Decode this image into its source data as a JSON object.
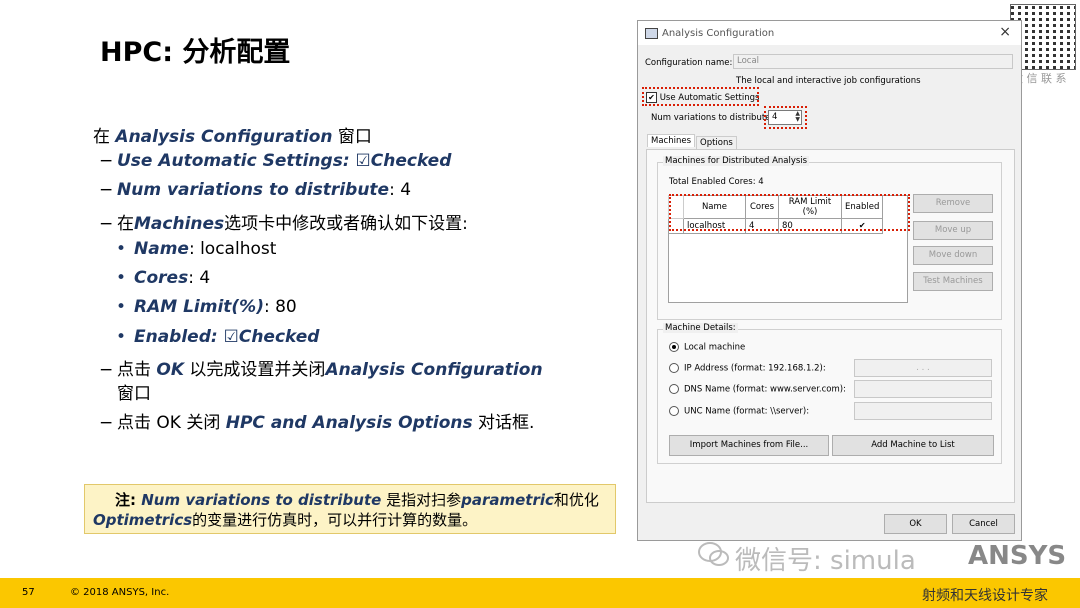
{
  "slide": {
    "title": "HPC: 分析配置",
    "b0_pre": "在 ",
    "b0_kw": "Analysis Configuration",
    "b0_post": " 窗口",
    "b1_dash": "−",
    "b1_kw": "Use Automatic Settings",
    "b1_post": ": ☑Checked",
    "b2_kw": "Num variations to distribute",
    "b2_post": ": 4",
    "b3_pre": "在",
    "b3_kw": "Machines",
    "b3_post": "选项卡中修改或者确认如下设置:",
    "sub_dot": "•",
    "s1_kw": "Name",
    "s1_post": ": localhost",
    "s2_kw": "Cores",
    "s2_post": ": 4",
    "s3_kw": "RAM Limit(%)",
    "s3_post": ": 80",
    "s4_kw": "Enabled: ☑Checked",
    "b4_pre": "点击 ",
    "b4_kw1": "OK",
    "b4_mid": " 以完成设置并关闭",
    "b4_kw2": "Analysis Configuration",
    "b4_line2": "窗口",
    "b5_pre": "点击 OK 关闭 ",
    "b5_kw": "HPC and Analysis Options",
    "b5_post": " 对话框.",
    "note_label": "注",
    "note_colon": ": ",
    "note_kw1": "Num variations  to distribute",
    "note_mid": " 是指对扫参",
    "note_kw2": "parametric",
    "note_post": "和优化",
    "note_kw3": "Optimetrics",
    "note_end": "的变量进行仿真时，可以并行计算的数量。",
    "page_number": "57",
    "copyright": "© 2018 ANSYS, Inc.",
    "watermark_left": "微信号: simula",
    "watermark_right": "ANSYS",
    "qr_caption": "微 信 联 系",
    "bottom_brand": "射频和天线设计专家"
  },
  "dialog": {
    "title": "Analysis Configuration",
    "close": "×",
    "config_name_label": "Configuration name:",
    "config_name_value": "Local",
    "description": "The local and interactive job configurations",
    "use_auto_label": "Use Automatic Settings",
    "use_auto_checked": "✔",
    "num_var_label": "Num variations to distribute:",
    "num_var_value": "4",
    "tabs": [
      "Machines",
      "Options"
    ],
    "group_machines": "Machines for Distributed Analysis",
    "total_cores": "Total Enabled Cores: 4",
    "table_headers": [
      "Name",
      "Cores",
      "RAM Limit (%)",
      "Enabled"
    ],
    "table_row": {
      "name": "localhost",
      "cores": "4",
      "ram": "80",
      "enabled": "✔"
    },
    "btn_remove": "Remove",
    "btn_move_up": "Move up",
    "btn_move_down": "Move down",
    "btn_test": "Test Machines",
    "group_details": "Machine Details:",
    "radio_local": "Local machine",
    "radio_ip": "IP Address (format: 192.168.1.2):",
    "ip_placeholder": ".        .        .",
    "radio_dns": "DNS Name (format: www.server.com):",
    "radio_unc": "UNC Name (format: \\\\server):",
    "btn_import": "Import Machines from File...",
    "btn_add": "Add Machine to List",
    "btn_ok": "OK",
    "btn_cancel": "Cancel"
  },
  "colors": {
    "accent_text": "#1f3864",
    "highlight": "#d81e05",
    "footer": "#fbc700",
    "note_bg": "#fdf3c6"
  }
}
